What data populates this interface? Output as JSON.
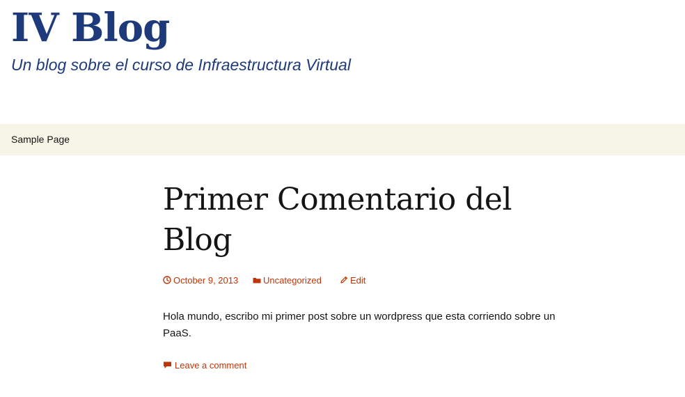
{
  "site": {
    "title": "IV Blog",
    "description": "Un blog sobre el curso de Infraestructura Virtual"
  },
  "nav": {
    "items": [
      {
        "label": "Sample Page"
      }
    ]
  },
  "post": {
    "title": "Primer Comentario del Blog",
    "date": "October 9, 2013",
    "category": "Uncategorized",
    "edit_label": "Edit",
    "content": "Hola mundo, escribo mi primer post sobre un wordpress que esta corriendo sobre un PaaS.",
    "comment_link": "Leave a comment"
  },
  "icons": {
    "date": "clock-icon",
    "category": "folder-icon",
    "edit": "pencil-icon",
    "comment": "speech-bubble-icon"
  },
  "colors": {
    "brand": "#1e3a7a",
    "link": "#bc360a",
    "nav_background": "#f7f5e7",
    "text": "#141412"
  }
}
